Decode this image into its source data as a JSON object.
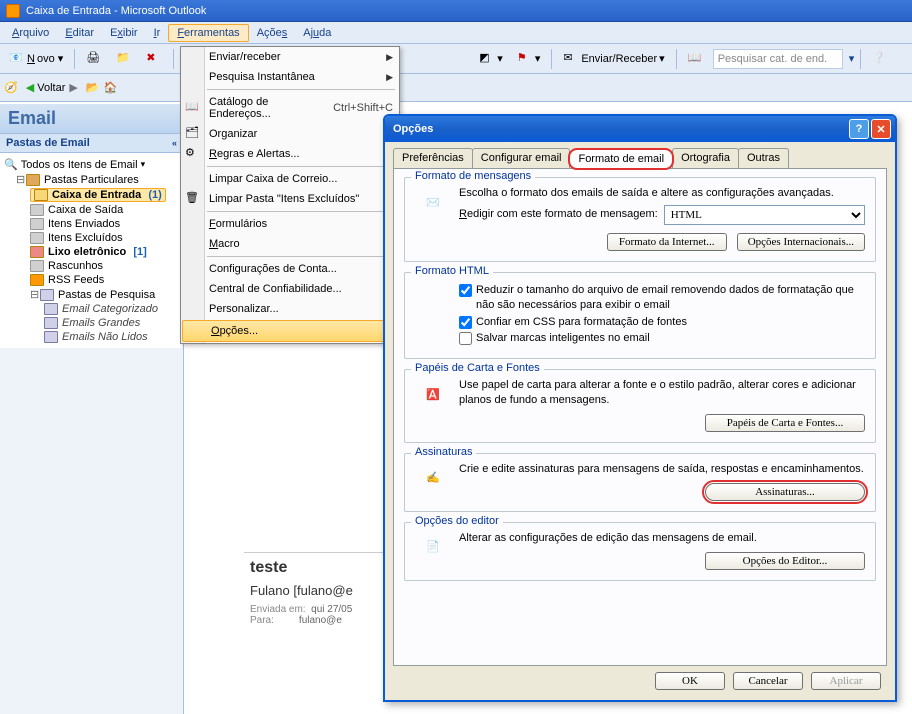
{
  "window": {
    "title": "Caixa de Entrada - Microsoft Outlook"
  },
  "menu": {
    "arquivo": "Arquivo",
    "editar": "Editar",
    "exibir": "Exibir",
    "ir": "Ir",
    "ferramentas": "Ferramentas",
    "acoes": "Ações",
    "ajuda": "Ajuda"
  },
  "toolbar": {
    "novo": "Novo",
    "enviar_receber": "Enviar/Receber",
    "search_placeholder": "Pesquisar cat. de end."
  },
  "toolbar2": {
    "voltar": "Voltar"
  },
  "nav": {
    "header": "Email",
    "sub": "Pastas de Email",
    "all": "Todos os Itens de Email",
    "root": "Pastas Particulares",
    "inbox": "Caixa de Entrada",
    "inbox_cnt": "(1)",
    "outbox": "Caixa de Saída",
    "sent": "Itens Enviados",
    "deleted": "Itens Excluídos",
    "junk": "Lixo eletrônico",
    "junk_cnt": "[1]",
    "drafts": "Rascunhos",
    "rss": "RSS Feeds",
    "search_folders": "Pastas de Pesquisa",
    "sf1": "Email Categorizado",
    "sf2": "Emails Grandes",
    "sf3": "Emails Não Lidos"
  },
  "dropdown": {
    "send_recv": "Enviar/receber",
    "instant": "Pesquisa Instantânea",
    "addrbook": "Catálogo de Endereços...",
    "addrbook_sc": "Ctrl+Shift+C",
    "organize": "Organizar",
    "rules": "Regras e Alertas...",
    "clean_mb": "Limpar Caixa de Correio...",
    "clean_del": "Limpar Pasta \"Itens Excluídos\"",
    "forms": "Formulários",
    "macro": "Macro",
    "accounts": "Configurações de Conta...",
    "trust": "Central de Confiabilidade...",
    "customize": "Personalizar...",
    "options": "Opções..."
  },
  "msg": {
    "subject": "teste",
    "from": "Fulano [fulano@e",
    "sent_lbl": "Enviada em:",
    "sent_val": "qui 27/05",
    "to_lbl": "Para:",
    "to_val": "fulano@e"
  },
  "dialog": {
    "title": "Opções",
    "tabs": {
      "pref": "Preferências",
      "cfg": "Configurar email",
      "fmt": "Formato de email",
      "ort": "Ortografia",
      "out": "Outras"
    },
    "g1": {
      "legend": "Formato de mensagens",
      "desc": "Escolha o formato dos emails de saída e altere as configurações avançadas.",
      "compose_lbl": "Redigir com este formato de mensagem:",
      "compose_val": "HTML",
      "btn_internet": "Formato da Internet...",
      "btn_intl": "Opções Internacionais..."
    },
    "g2": {
      "legend": "Formato HTML",
      "c1": "Reduzir o tamanho do arquivo de email removendo dados de formatação que não são necessários para exibir o email",
      "c2": "Confiar em CSS para formatação de fontes",
      "c3": "Salvar marcas inteligentes no email"
    },
    "g3": {
      "legend": "Papéis de Carta e Fontes",
      "desc": "Use papel de carta para alterar a fonte e o estilo padrão, alterar cores e adicionar planos de fundo a mensagens.",
      "btn": "Papéis de Carta e Fontes..."
    },
    "g4": {
      "legend": "Assinaturas",
      "desc": "Crie e edite assinaturas para mensagens de saída, respostas e encaminhamentos.",
      "btn": "Assinaturas..."
    },
    "g5": {
      "legend": "Opções do editor",
      "desc": "Alterar as configurações de edição das mensagens de email.",
      "btn": "Opções do Editor..."
    },
    "ok": "OK",
    "cancel": "Cancelar",
    "apply": "Aplicar"
  }
}
